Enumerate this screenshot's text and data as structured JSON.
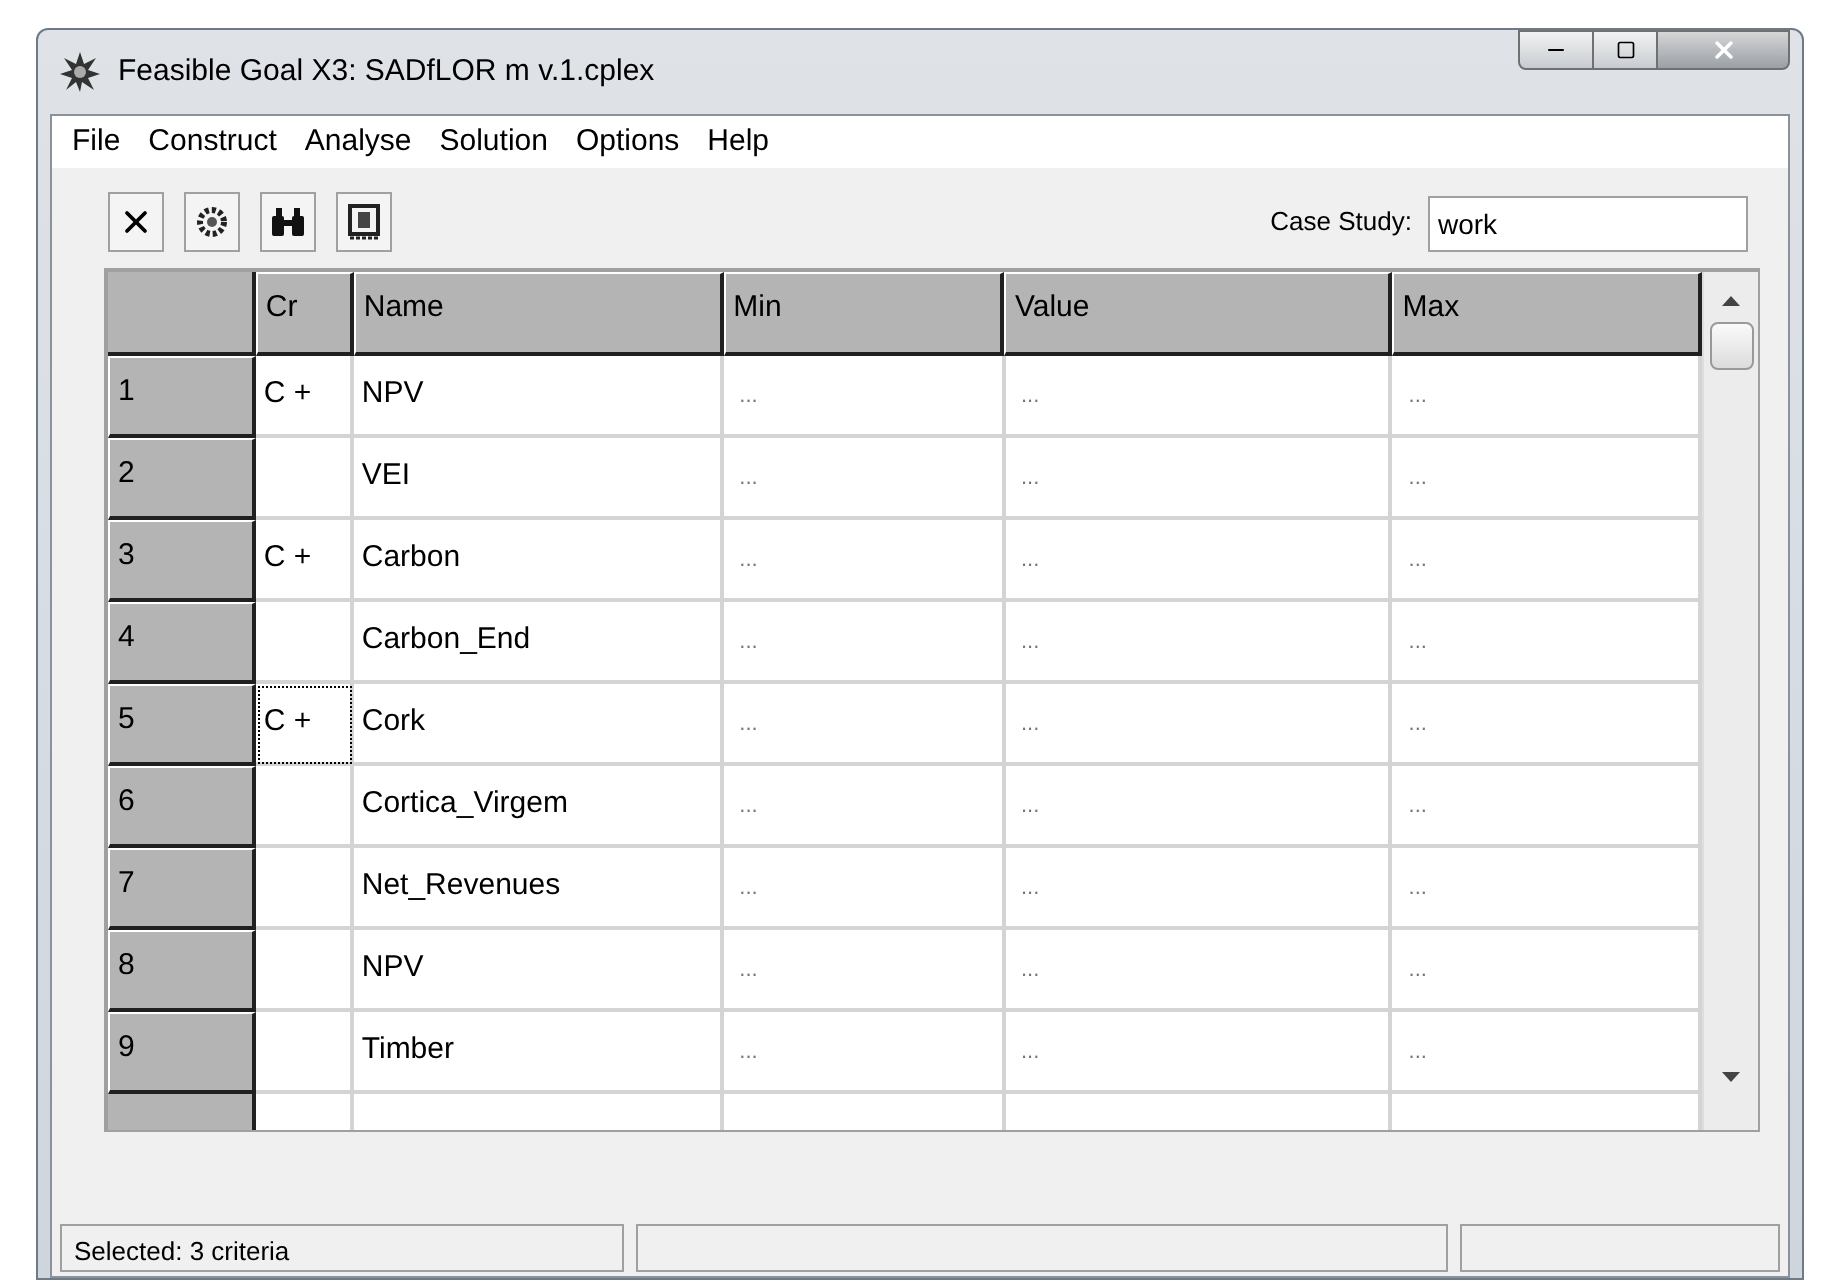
{
  "window": {
    "title": "Feasible Goal X3: SADfLOR m v.1.cplex"
  },
  "menu": [
    "File",
    "Construct",
    "Analyse",
    "Solution",
    "Options",
    "Help"
  ],
  "toolbar": [
    {
      "kind": "close"
    },
    {
      "kind": "gear"
    },
    {
      "kind": "binoculars"
    },
    {
      "kind": "film"
    }
  ],
  "case_study": {
    "label": "Case Study:",
    "value": "work"
  },
  "table": {
    "columns": [
      "Cr",
      "Name",
      "Min",
      "Value",
      "Max"
    ],
    "rows": [
      {
        "number": "1",
        "cr": "C +",
        "name": "NPV",
        "min": "...",
        "value": "...",
        "max": "...",
        "focused": false
      },
      {
        "number": "2",
        "name": "VEI",
        "min": "...",
        "value": "...",
        "max": "...",
        "focused": false
      },
      {
        "number": "3",
        "cr": "C +",
        "name": "Carbon",
        "min": "...",
        "value": "...",
        "max": "...",
        "focused": false
      },
      {
        "number": "4",
        "name": "Carbon_End",
        "min": "...",
        "value": "...",
        "max": "...",
        "focused": false
      },
      {
        "number": "5",
        "cr": "C +",
        "name": "Cork",
        "min": "...",
        "value": "...",
        "max": "...",
        "focused": true
      },
      {
        "number": "6",
        "name": "Cortica_Virgem",
        "min": "...",
        "value": "...",
        "max": "...",
        "focused": false
      },
      {
        "number": "7",
        "name": "Net_Revenues",
        "min": "...",
        "value": "...",
        "max": "...",
        "focused": false
      },
      {
        "number": "8",
        "name": "NPV",
        "min": "...",
        "value": "...",
        "max": "...",
        "focused": false
      },
      {
        "number": "9",
        "name": "Timber",
        "min": "...",
        "value": "...",
        "max": "...",
        "focused": false
      }
    ]
  },
  "status_bar": [
    "Selected: 3 criteria"
  ]
}
